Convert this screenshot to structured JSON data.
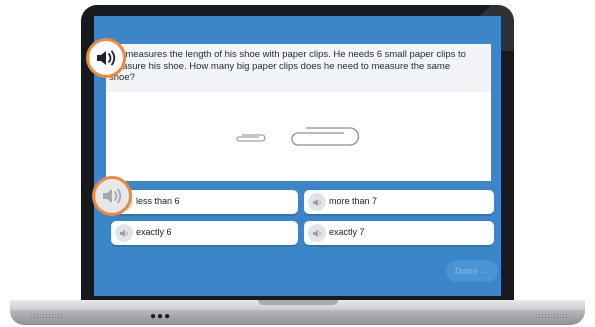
{
  "question": {
    "text": "Ric measures the length of his shoe with paper clips. He needs 6 small paper clips to measure his shoe. How many big paper clips does he need to measure the same shoe?"
  },
  "choices": [
    {
      "label": "less than 6"
    },
    {
      "label": "more than 7"
    },
    {
      "label": "exactly 6"
    },
    {
      "label": "exactly 7"
    }
  ],
  "done_button": {
    "label": "Done →"
  },
  "icons": {
    "speaker": "speaker-icon",
    "small_clip": "small-paper-clip-icon",
    "big_clip": "big-paper-clip-icon"
  },
  "colors": {
    "screen_background": "#3b85c9",
    "highlight_ring": "#f0883c",
    "done_button": "#4a93d4"
  }
}
